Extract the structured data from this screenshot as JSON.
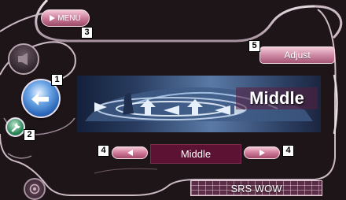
{
  "menu_button": {
    "label": "MENU",
    "icon": "play-triangle-icon"
  },
  "adjust_button": {
    "label": "Adjust"
  },
  "display": {
    "label": "Middle"
  },
  "selector": {
    "value": "Middle",
    "prev_icon": "left-triangle-icon",
    "next_icon": "right-triangle-icon"
  },
  "srs_button": {
    "label": "SRS WOW"
  },
  "callouts": {
    "c1": "1",
    "c2": "2",
    "c3": "3",
    "c4a": "4",
    "c4b": "4",
    "c5": "5"
  },
  "side_icons": [
    "speaker-icon",
    "return-arrow-icon",
    "wrench-icon",
    "knob-icon"
  ],
  "colors": {
    "frame_dark": "#1e1519",
    "frame_border": "#d3c4cc",
    "button_pink": "#cf7a9a",
    "value_field": "#5c1232",
    "return_blue": "#2a66b8",
    "wrench_green": "#2d8b5b"
  }
}
